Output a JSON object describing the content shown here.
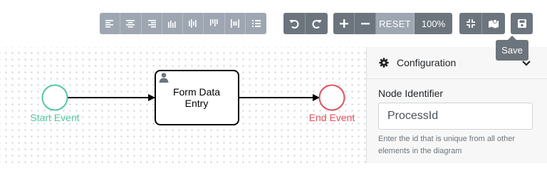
{
  "toolbar": {
    "align_buttons": [
      "align-left-icon",
      "align-center-icon",
      "align-right-icon",
      "align-bottom-icon",
      "align-middle-icon",
      "align-top-icon",
      "distribute-horizontal-icon",
      "distribute-vertical-icon"
    ],
    "undo_icon": "undo-icon",
    "redo_icon": "redo-icon",
    "zoom_in_icon": "plus-icon",
    "zoom_out_icon": "minus-icon",
    "reset_label": "RESET",
    "zoom_level": "100%",
    "fullscreen_icon": "collapse-icon",
    "minimap_icon": "map-icon",
    "save_icon": "save-icon",
    "save_tooltip": "Save"
  },
  "diagram": {
    "start_event_label": "Start Event",
    "task_label_line1": "Form Data",
    "task_label_line2": "Entry",
    "end_event_label": "End Event",
    "colors": {
      "start": "#53c7a2",
      "end": "#e0515d",
      "task_border": "#000000"
    }
  },
  "panel": {
    "header_title": "Configuration",
    "field_label": "Node Identifier",
    "field_value": "ProcessId",
    "help_text": "Enter the id that is unique from all other elements in the diagram"
  }
}
